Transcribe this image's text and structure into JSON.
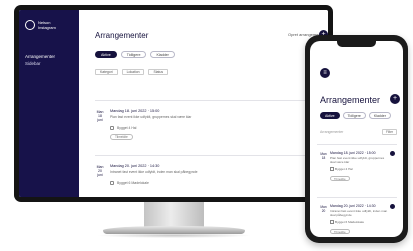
{
  "desktop": {
    "brand": {
      "name": "Nelson Instagram",
      "logo_icon": "circle-logo-icon"
    },
    "sidebar": {
      "items": [
        {
          "label": "Arrangementer"
        },
        {
          "label": "Sidebar"
        }
      ]
    },
    "header": {
      "title": "Arrangementer",
      "action": "Opret arrangement"
    },
    "tabs": [
      {
        "label": "Aktive"
      },
      {
        "label": "Tidligere"
      },
      {
        "label": "Kladder"
      }
    ],
    "filters": [
      {
        "label": "Kategori"
      },
      {
        "label": "Lokation"
      },
      {
        "label": "Status"
      }
    ],
    "filter_right": "Søg arrangement",
    "events": [
      {
        "date": "Man 18 juni",
        "time": "Mandag 18. juni 2022 · 15:00",
        "description": "Plan fast event ikke udfyldt, gruppernes skal være klar",
        "location": "Bygget 4 Hal",
        "button": "Tilmeldte",
        "status": "Aktiv"
      },
      {
        "date": "Man 20 juni",
        "time": "Mandag 20. juni 2022 · 14:30",
        "description": "Intranet fast event ikke udfyldt, inden man skal påbegynde",
        "location": "Bygget 6 Mødelokale",
        "button": "Tilmeldte",
        "status": "Aktiv"
      }
    ]
  },
  "phone": {
    "menu_icon": "menu-icon",
    "title": "Arrangementer",
    "tabs": [
      {
        "label": "Aktive"
      },
      {
        "label": "Tidligere"
      },
      {
        "label": "Kladder"
      }
    ],
    "search_placeholder": "Arrangementer",
    "filter_label": "Filter",
    "events": [
      {
        "date": "Man 18",
        "time": "Mandag 18. juni 2022 · 15:00",
        "description": "Plan fast event ikke udfyldt, gruppernes skal være klar",
        "location": "Bygget 4 Hal",
        "button": "Tilmeldte"
      },
      {
        "date": "Man 20",
        "time": "Mandag 20. juni 2022 · 14:30",
        "description": "Intranet fast event ikke udfyldt, inden man skal påbegynde",
        "location": "Bygget 6 Mødelokale",
        "button": "Tilmeldte"
      }
    ]
  },
  "colors": {
    "primary": "#16123d",
    "sidebar": "#17124a",
    "device": "#141414"
  }
}
